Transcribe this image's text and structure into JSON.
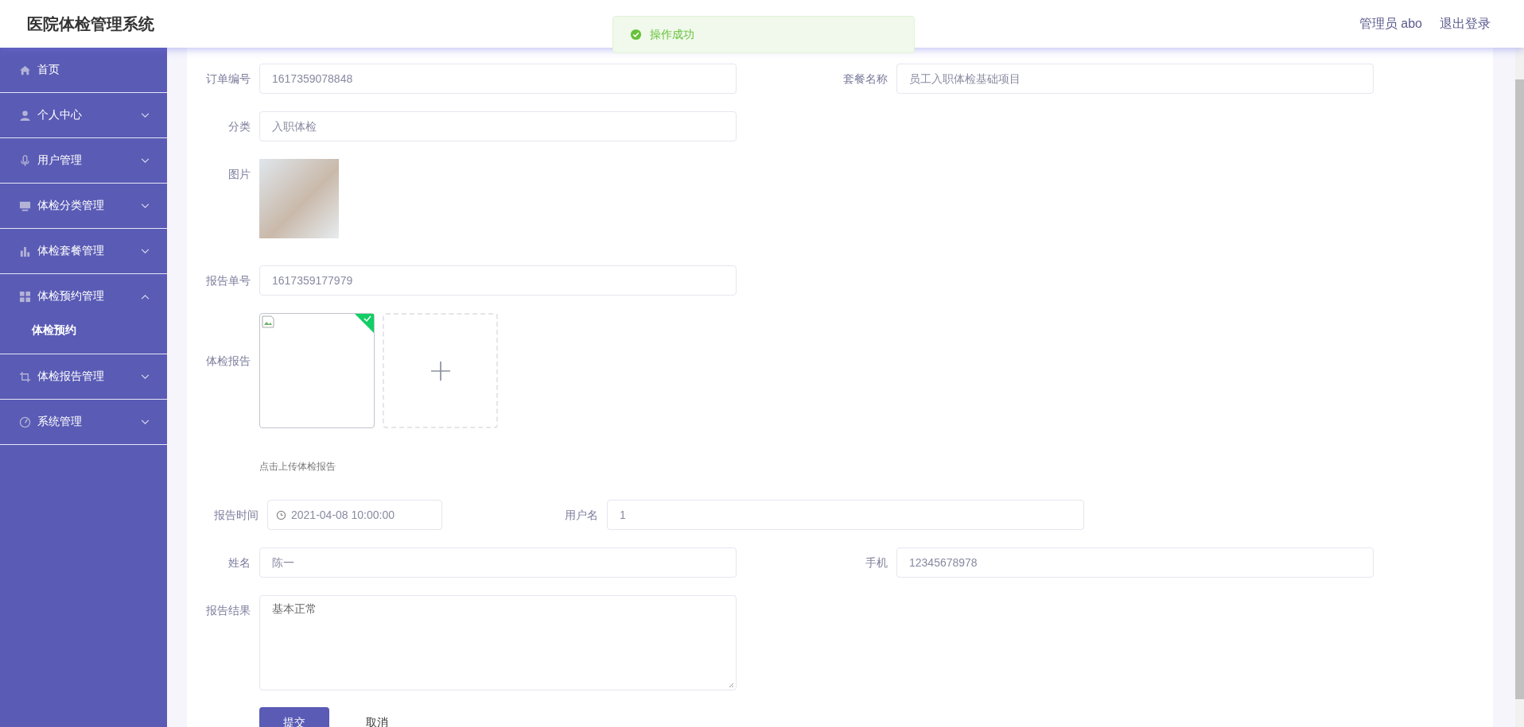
{
  "header": {
    "title": "医院体检管理系统",
    "user": "管理员 abo",
    "logout": "退出登录"
  },
  "toast": {
    "text": "操作成功"
  },
  "sidebar": {
    "items": [
      {
        "label": "首页"
      },
      {
        "label": "个人中心",
        "expanded": false
      },
      {
        "label": "用户管理",
        "expanded": false
      },
      {
        "label": "体检分类管理",
        "expanded": false
      },
      {
        "label": "体检套餐管理",
        "expanded": false
      },
      {
        "label": "体检预约管理",
        "expanded": true,
        "children": [
          {
            "label": "体检预约"
          }
        ]
      },
      {
        "label": "体检报告管理",
        "expanded": false
      },
      {
        "label": "系统管理",
        "expanded": false
      }
    ]
  },
  "form": {
    "rows": [
      {
        "left": {
          "kind": "text",
          "label": "订单编号",
          "value": "1617359078848"
        },
        "right": {
          "kind": "text",
          "label": "套餐名称",
          "value": "员工入职体检基础项目"
        }
      },
      {
        "left": {
          "kind": "text",
          "label": "分类",
          "value": "入职体检"
        }
      },
      {
        "left": {
          "kind": "image",
          "label": "图片"
        }
      },
      {
        "left": {
          "kind": "text",
          "label": "报告单号",
          "value": "1617359177979"
        }
      },
      {
        "left": {
          "kind": "upload",
          "label": "体检报告",
          "hint": "点击上传体检报告",
          "uploaded": true
        }
      },
      {
        "left": {
          "kind": "date",
          "label": "报告时间",
          "value": "2021-04-08 10:00:00"
        },
        "right": {
          "kind": "text",
          "label": "用户名",
          "value": "1"
        }
      },
      {
        "left": {
          "kind": "text",
          "label": "姓名",
          "value": "陈一"
        },
        "right": {
          "kind": "text",
          "label": "手机",
          "value": "12345678978"
        }
      },
      {
        "left": {
          "kind": "textarea",
          "label": "报告结果",
          "value": "基本正常"
        }
      }
    ],
    "buttons": [
      {
        "label": "提交",
        "kind": "primary"
      },
      {
        "label": "取消",
        "kind": "plain"
      }
    ]
  }
}
